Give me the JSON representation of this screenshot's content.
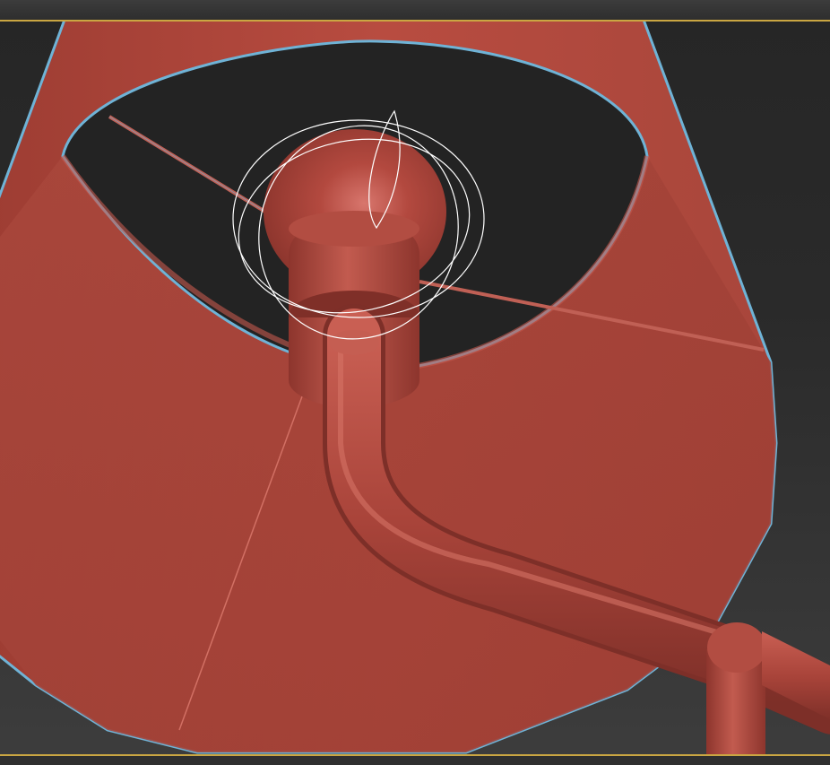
{
  "viewport": {
    "active": true,
    "selection_outline_color": "#6fb3d6",
    "active_border_color": "#caa642",
    "background_color": "#262626"
  },
  "scene": {
    "objects": [
      {
        "name": "lamp-shade",
        "color": "#a8483c",
        "selected": true
      },
      {
        "name": "bulb-socket",
        "color": "#b04a40"
      },
      {
        "name": "lamp-arm",
        "color": "#b04a40"
      },
      {
        "name": "spot-light-gizmo",
        "color": "#ffffff"
      }
    ]
  }
}
